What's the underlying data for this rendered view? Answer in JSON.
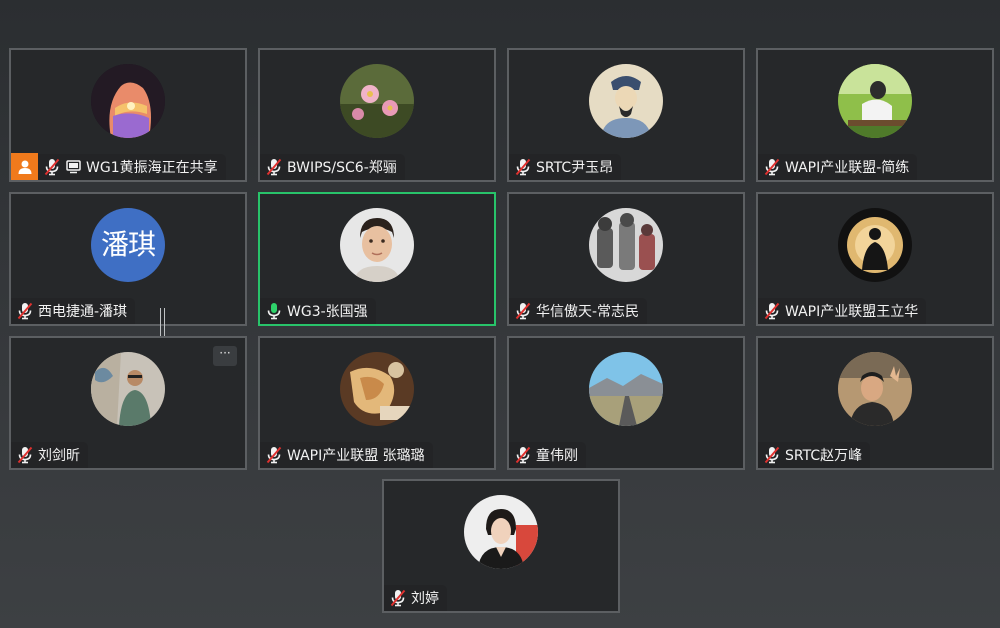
{
  "participants": [
    {
      "name": "WG1黄振海正在共享",
      "mic": "muted",
      "host": true,
      "sharing": true,
      "avatar": "sunset-cave-photo"
    },
    {
      "name": "BWIPS/SC6-郑骊",
      "mic": "muted",
      "avatar": "pink-flowers-photo"
    },
    {
      "name": "SRTC尹玉昂",
      "mic": "muted",
      "avatar": "ancient-scholar-painting"
    },
    {
      "name": "WAPI产业联盟-简练",
      "mic": "muted",
      "avatar": "person-bench-photo"
    },
    {
      "name": "西电捷通-潘琪",
      "mic": "muted",
      "avatar_text": "潘琪",
      "avatar_color": "#3f6fc4"
    },
    {
      "name": "WG3-张国强",
      "mic": "active",
      "active_speaker": true,
      "avatar": "young-man-portrait"
    },
    {
      "name": "华信傲天-常志民",
      "mic": "muted",
      "avatar": "robots-illustration"
    },
    {
      "name": "WAPI产业联盟王立华",
      "mic": "muted",
      "avatar": "silhouette-spotlight"
    },
    {
      "name": "刘剑昕",
      "mic": "muted",
      "avatar": "man-graffiti-wall-photo",
      "more_label": "···"
    },
    {
      "name": "WAPI产业联盟 张璐璐",
      "mic": "muted",
      "avatar": "food-closeup-photo"
    },
    {
      "name": "童伟刚",
      "mic": "muted",
      "avatar": "mountain-road-photo"
    },
    {
      "name": "SRTC赵万峰",
      "mic": "muted",
      "avatar": "man-peace-sign-photo"
    },
    {
      "name": "刘婷",
      "mic": "muted",
      "avatar": "woman-portrait-photo"
    }
  ],
  "colors": {
    "active_border": "#28c36a",
    "host_badge": "#f07a1c",
    "muted_icon": "#f2f2f2",
    "muted_slash": "#e0312f",
    "active_mic": "#2fd26b"
  }
}
